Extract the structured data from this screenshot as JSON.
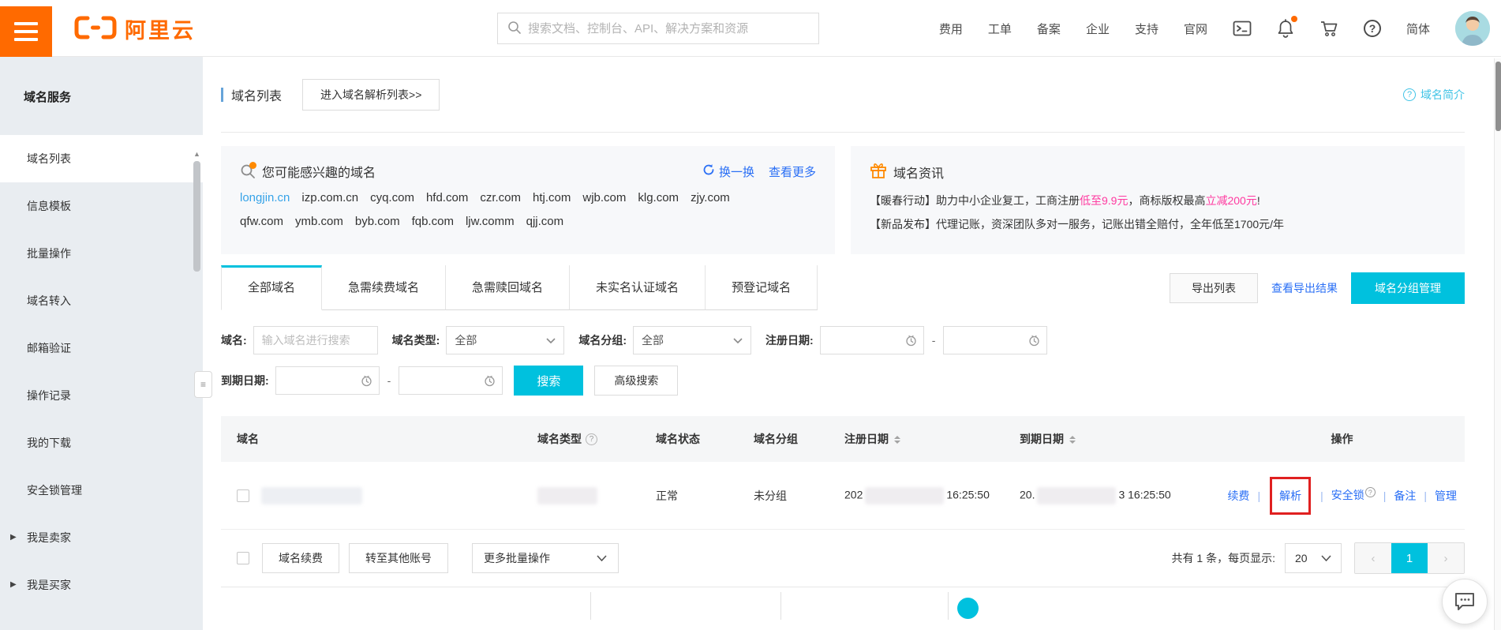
{
  "topbar": {
    "logo_text": "阿里云",
    "search_placeholder": "搜索文档、控制台、API、解决方案和资源",
    "nav": [
      "费用",
      "工单",
      "备案",
      "企业",
      "支持",
      "官网"
    ],
    "locale": "简体"
  },
  "sidebar": {
    "title": "域名服务",
    "items": [
      {
        "label": "域名列表",
        "cls": "active"
      },
      {
        "label": "信息模板"
      },
      {
        "label": "批量操作"
      },
      {
        "label": "域名转入"
      },
      {
        "label": "邮箱验证"
      },
      {
        "label": "操作记录"
      },
      {
        "label": "我的下载"
      },
      {
        "label": "安全锁管理"
      },
      {
        "label": "我是卖家",
        "cls": "has-arrow"
      },
      {
        "label": "我是买家",
        "cls": "has-arrow"
      }
    ]
  },
  "page": {
    "title": "域名列表",
    "enter_dns_button": "进入域名解析列表>>",
    "intro_link": "域名简介"
  },
  "interest": {
    "title": "您可能感兴趣的域名",
    "refresh": "换一换",
    "more": "查看更多",
    "line1": [
      {
        "t": "longjin.cn",
        "cls": "cyan"
      },
      {
        "t": "izp.com.cn"
      },
      {
        "t": "cyq.com"
      },
      {
        "t": "hfd.com"
      },
      {
        "t": "czr.com"
      },
      {
        "t": "htj.com"
      },
      {
        "t": "wjb.com"
      },
      {
        "t": "klg.com"
      },
      {
        "t": "zjy.com"
      }
    ],
    "line2": [
      {
        "t": "qfw.com"
      },
      {
        "t": "ymb.com"
      },
      {
        "t": "byb.com"
      },
      {
        "t": "fqb.com"
      },
      {
        "t": "ljw.comm"
      },
      {
        "t": "qjj.com"
      }
    ]
  },
  "news": {
    "title": "域名资讯",
    "line1_a": "【暖春行动】助力中小企业复工，工商注册",
    "line1_b": "低至9.9元",
    "line1_c": "，商标版权最高",
    "line1_d": "立减200元",
    "line1_e": "!",
    "line2": "【新品发布】代理记账，资深团队多对一服务，记账出错全赔付，全年低至1700元/年"
  },
  "tabs": [
    {
      "label": "全部域名",
      "cls": "active"
    },
    {
      "label": "急需续费域名"
    },
    {
      "label": "急需赎回域名"
    },
    {
      "label": "未实名认证域名"
    },
    {
      "label": "预登记域名"
    }
  ],
  "toolbar": {
    "export_label": "导出列表",
    "view_export_label": "查看导出结果",
    "group_manage_label": "域名分组管理"
  },
  "filters": {
    "domain_label": "域名:",
    "domain_placeholder": "输入域名进行搜索",
    "type_label": "域名类型:",
    "type_value": "全部",
    "group_label": "域名分组:",
    "group_value": "全部",
    "reg_date_label": "注册日期:",
    "expire_date_label": "到期日期:",
    "range_sep": "-",
    "search_label": "搜索",
    "advanced_label": "高级搜索"
  },
  "table": {
    "columns": {
      "domain": "域名",
      "type": "域名类型",
      "status": "域名状态",
      "group": "域名分组",
      "reg": "注册日期",
      "exp": "到期日期",
      "action": "操作"
    },
    "row": {
      "status": "正常",
      "group": "未分组",
      "reg_prefix": "202",
      "reg_suffix": "16:25:50",
      "exp_prefix": "20.",
      "exp_suffix": "3 16:25:50",
      "actions": {
        "renew": "续费",
        "resolve": "解析",
        "lock": "安全锁",
        "remark": "备注",
        "manage": "管理"
      }
    }
  },
  "batch": {
    "renew_label": "域名续费",
    "transfer_label": "转至其他账号",
    "more_label": "更多批量操作"
  },
  "pagination": {
    "summary": "共有 1 条，每页显示:",
    "page_size": "20",
    "current_page": "1"
  },
  "colors": {
    "accent_cyan": "#00c1de",
    "link_blue": "#2a6ff5",
    "brand_orange": "#ff6a00",
    "promo_pink": "#ff3aa0",
    "annotation_red": "#e02020",
    "intro_cyan": "#3fc3e6"
  }
}
